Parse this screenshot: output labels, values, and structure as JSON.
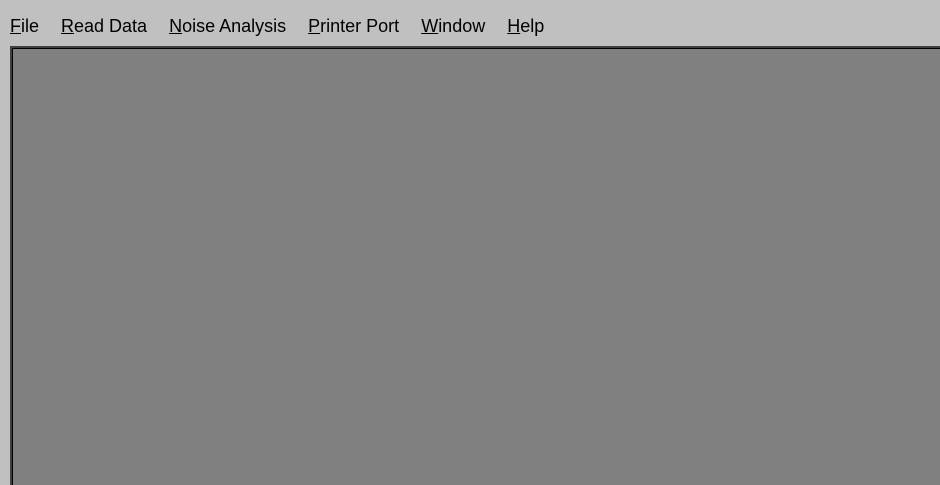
{
  "menubar": {
    "items": [
      {
        "id": "file",
        "accel": "F",
        "rest": "ile"
      },
      {
        "id": "read-data",
        "accel": "R",
        "rest": "ead Data"
      },
      {
        "id": "noise-analysis",
        "accel": "N",
        "rest": "oise Analysis"
      },
      {
        "id": "printer-port",
        "accel": "P",
        "rest": "rinter Port"
      },
      {
        "id": "window",
        "accel": "W",
        "rest": "indow"
      },
      {
        "id": "help",
        "accel": "H",
        "rest": "elp"
      }
    ]
  },
  "colors": {
    "menubar_bg": "#c0c0c0",
    "mdi_client_bg": "#808080",
    "client_border": "#404040"
  }
}
